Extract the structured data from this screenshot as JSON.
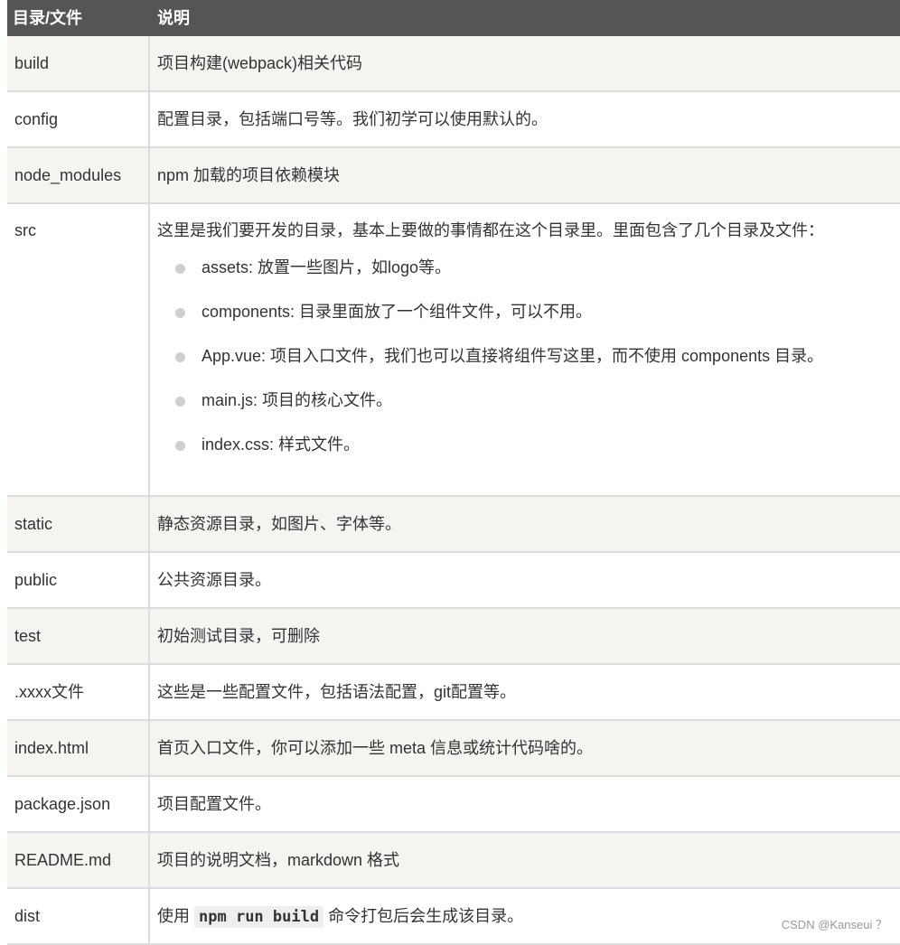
{
  "header": {
    "col1": "目录/文件",
    "col2": "说明"
  },
  "rows": [
    {
      "name": "build",
      "desc": "项目构建(webpack)相关代码"
    },
    {
      "name": "config",
      "desc": "配置目录，包括端口号等。我们初学可以使用默认的。"
    },
    {
      "name": "node_modules",
      "desc": "npm 加载的项目依赖模块"
    },
    {
      "name": "src",
      "desc": "这里是我们要开发的目录，基本上要做的事情都在这个目录里。里面包含了几个目录及文件：",
      "items": [
        "assets: 放置一些图片，如logo等。",
        "components: 目录里面放了一个组件文件，可以不用。",
        "App.vue: 项目入口文件，我们也可以直接将组件写这里，而不使用 components 目录。",
        "main.js: 项目的核心文件。",
        "index.css: 样式文件。"
      ]
    },
    {
      "name": "static",
      "desc": "静态资源目录，如图片、字体等。"
    },
    {
      "name": "public",
      "desc": "公共资源目录。"
    },
    {
      "name": "test",
      "desc": "初始测试目录，可删除"
    },
    {
      "name": ".xxxx文件",
      "desc": "这些是一些配置文件，包括语法配置，git配置等。"
    },
    {
      "name": "index.html",
      "desc": "首页入口文件，你可以添加一些 meta 信息或统计代码啥的。"
    },
    {
      "name": "package.json",
      "desc": "项目配置文件。"
    },
    {
      "name": "README.md",
      "desc": "项目的说明文档，markdown 格式"
    },
    {
      "name": "dist",
      "desc_before": "使用",
      "desc_code": "npm run build",
      "desc_after": "命令打包后会生成该目录。"
    }
  ],
  "watermark": "CSDN @Kanseui ？"
}
